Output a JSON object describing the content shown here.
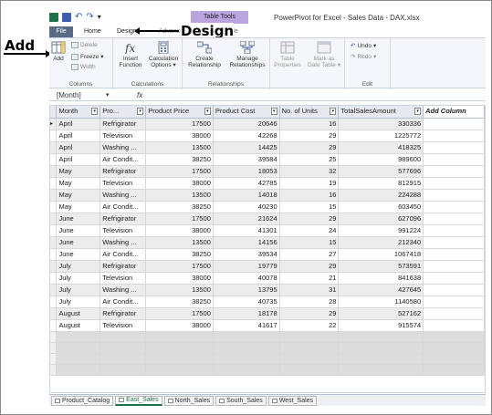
{
  "titlebar": {
    "table_tools": "Table Tools",
    "window_title": "PowerPivot for Excel - Sales Data - DAX.xlsx"
  },
  "tabs": {
    "file": "File",
    "home": "Home",
    "design": "Design",
    "advanced": "Advanced",
    "table": "Table"
  },
  "annotations": {
    "add": "Add",
    "design": "Design"
  },
  "ribbon": {
    "columns": {
      "label": "Columns",
      "add": "Add",
      "delete": "Delete",
      "freeze": "Freeze",
      "width": "Width"
    },
    "calculations": {
      "label": "Calculations",
      "insert_function_1": "Insert",
      "insert_function_2": "Function",
      "calc_options_1": "Calculation",
      "calc_options_2": "Options"
    },
    "relationships": {
      "label": "Relationships",
      "create_1": "Create",
      "create_2": "Relationship",
      "manage_1": "Manage",
      "manage_2": "Relationships"
    },
    "table": {
      "props_1": "Table",
      "props_2": "Properties",
      "mark_1": "Mark as",
      "mark_2": "Date Table"
    },
    "edit": {
      "label": "Edit",
      "undo": "Undo",
      "redo": "Redo"
    }
  },
  "formula_bar": {
    "name_box": "[Month]",
    "fx": "fx"
  },
  "grid": {
    "headers": [
      "Month",
      "Pro...",
      "Product Price",
      "Product Cost",
      "No. of Units",
      "TotalSalesAmount",
      "Add Column"
    ],
    "rows": [
      [
        "April",
        "Refrigirator",
        "17500",
        "20646",
        "16",
        "330336"
      ],
      [
        "April",
        "Television",
        "38000",
        "42268",
        "29",
        "1225772"
      ],
      [
        "April",
        "Washing ...",
        "13500",
        "14425",
        "29",
        "418325"
      ],
      [
        "April",
        "Air Condit...",
        "38250",
        "39584",
        "25",
        "989600"
      ],
      [
        "May",
        "Refrigirator",
        "17500",
        "18053",
        "32",
        "577696"
      ],
      [
        "May",
        "Television",
        "38000",
        "42785",
        "19",
        "812915"
      ],
      [
        "May",
        "Washing ...",
        "13500",
        "14018",
        "16",
        "224288"
      ],
      [
        "May",
        "Air Condit...",
        "38250",
        "40230",
        "15",
        "603450"
      ],
      [
        "June",
        "Refrigirator",
        "17500",
        "21624",
        "29",
        "627096"
      ],
      [
        "June",
        "Television",
        "38000",
        "41301",
        "24",
        "991224"
      ],
      [
        "June",
        "Washing ...",
        "13500",
        "14156",
        "15",
        "212340"
      ],
      [
        "June",
        "Air Condit...",
        "38250",
        "39534",
        "27",
        "1067418"
      ],
      [
        "July",
        "Refrigirator",
        "17500",
        "19779",
        "29",
        "573591"
      ],
      [
        "July",
        "Television",
        "38000",
        "40078",
        "21",
        "841638"
      ],
      [
        "July",
        "Washing ...",
        "13500",
        "13795",
        "31",
        "427645"
      ],
      [
        "July",
        "Air Condit...",
        "38250",
        "40735",
        "28",
        "1140580"
      ],
      [
        "August",
        "Refrigirator",
        "17500",
        "18178",
        "29",
        "527162"
      ],
      [
        "August",
        "Television",
        "38000",
        "41617",
        "22",
        "915574"
      ]
    ]
  },
  "sheet_tabs": [
    "Product_Catalog",
    "East_Sales",
    "North_Sales",
    "South_Sales",
    "West_Sales"
  ],
  "active_sheet": "East_Sales"
}
